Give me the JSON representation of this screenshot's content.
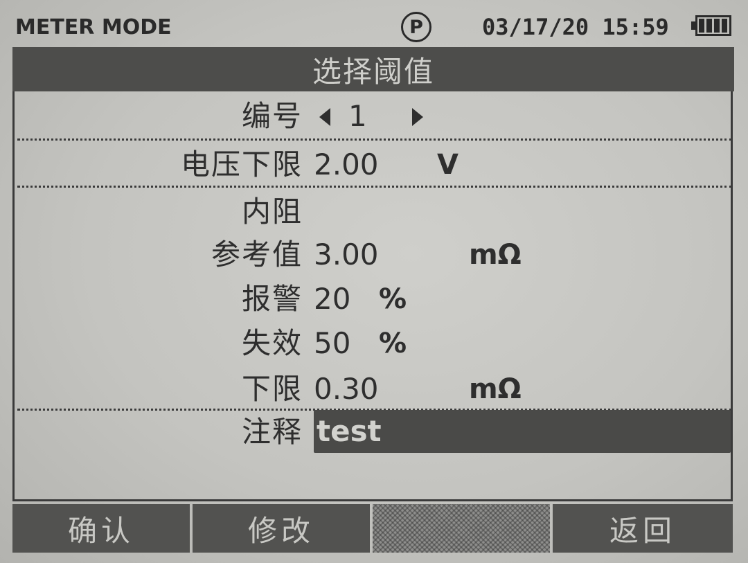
{
  "status": {
    "mode": "METER MODE",
    "p_icon_label": "P",
    "datetime": "03/17/20 15:59",
    "battery_icon": "battery-full-icon"
  },
  "title": "选择阈值",
  "fields": {
    "number": {
      "label": "编号",
      "value": "1"
    },
    "voltage_lower": {
      "label": "电压下限",
      "value": "2.00",
      "unit": "V"
    },
    "resistance": {
      "label": "内阻"
    },
    "reference": {
      "label": "参考值",
      "value": "3.00",
      "unit": "mΩ"
    },
    "alarm": {
      "label": "报警",
      "value": "20",
      "unit": "%"
    },
    "failure": {
      "label": "失效",
      "value": "50",
      "unit": "%"
    },
    "lower": {
      "label": "下限",
      "value": "0.30",
      "unit": "mΩ"
    },
    "note": {
      "label": "注释",
      "value": "test"
    }
  },
  "softkeys": {
    "confirm": "确认",
    "modify": "修改",
    "empty": "",
    "back": "返回"
  },
  "colors": {
    "screen_bg": "#c4c4c0",
    "bar_dark": "#4d4d4b",
    "text": "#2e2e2e"
  }
}
